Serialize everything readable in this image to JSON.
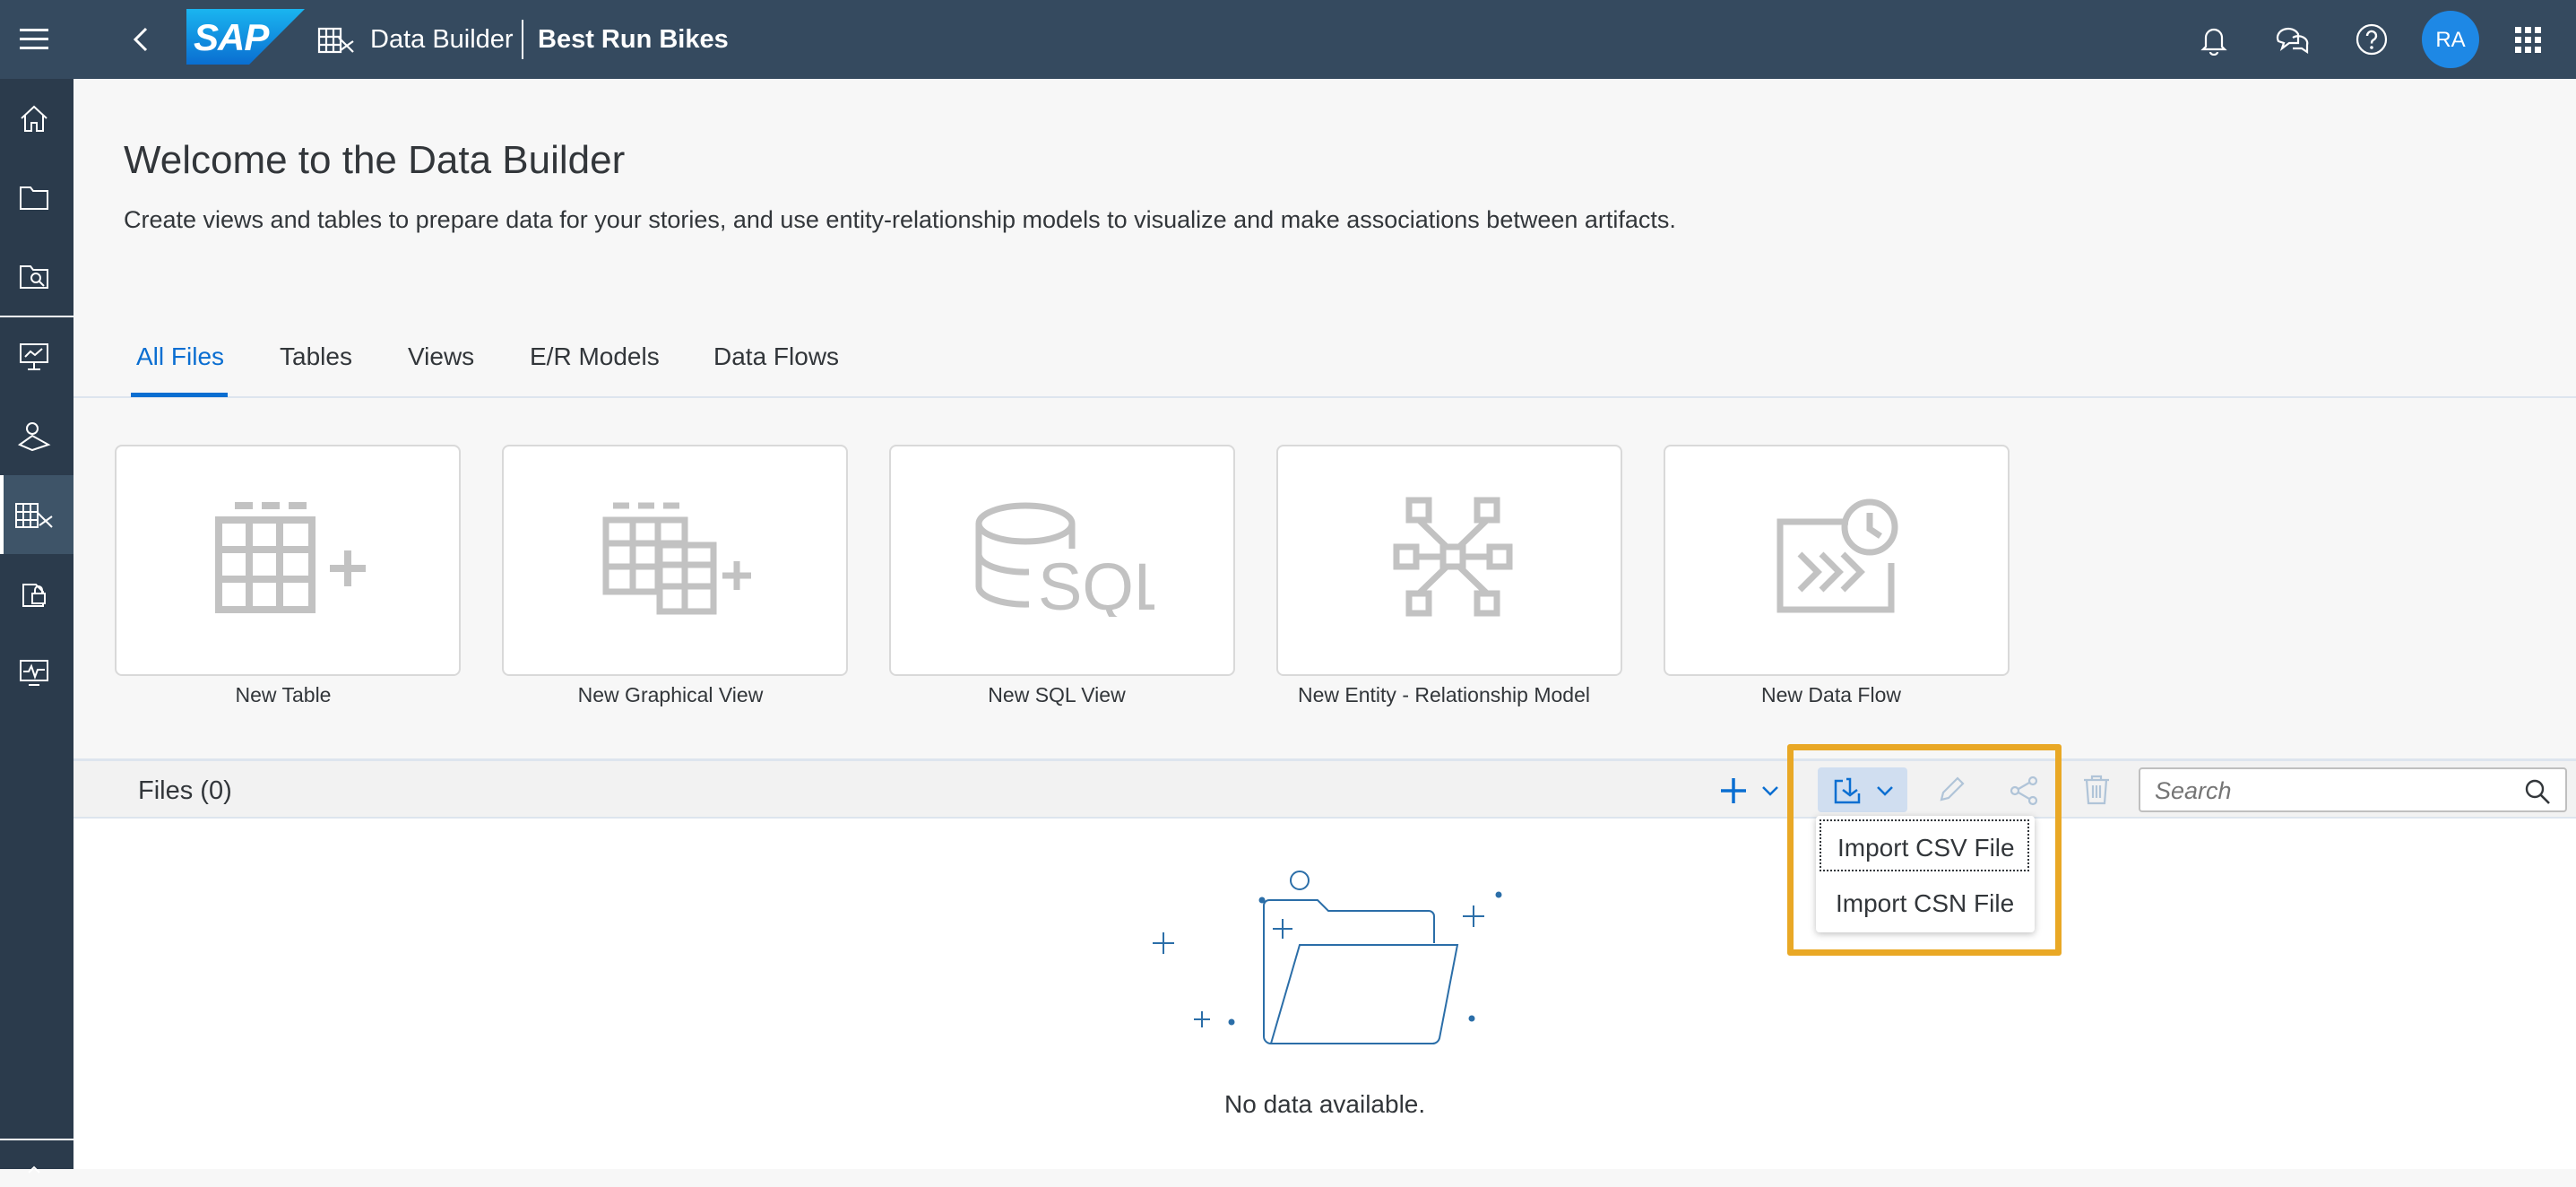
{
  "shell": {
    "logo_text": "SAP",
    "app_name": "Data Builder",
    "space_name": "Best Run Bikes",
    "avatar_initials": "RA"
  },
  "header": {
    "title": "Welcome to the Data Builder",
    "description": "Create views and tables to prepare data for your stories, and use entity-relationship models to visualize and make associations between artifacts."
  },
  "tabs": [
    {
      "label": "All Files",
      "selected": true
    },
    {
      "label": "Tables"
    },
    {
      "label": "Views"
    },
    {
      "label": "E/R Models"
    },
    {
      "label": "Data Flows"
    }
  ],
  "tiles": [
    {
      "label": "New Table",
      "icon": "table-add-icon"
    },
    {
      "label": "New Graphical View",
      "icon": "graphical-view-icon"
    },
    {
      "label": "New SQL View",
      "icon": "sql-icon"
    },
    {
      "label": "New Entity - Relationship Model",
      "icon": "er-model-icon"
    },
    {
      "label": "New Data Flow",
      "icon": "data-flow-icon"
    }
  ],
  "files": {
    "title": "Files (0)",
    "search_placeholder": "Search",
    "empty_text": "No data available."
  },
  "import_menu": {
    "items": [
      "Import CSV File",
      "Import CSN File"
    ]
  },
  "colors": {
    "shell_bg": "#354a5f",
    "sidebar_bg": "#2b3b4c",
    "accent": "#0a6ed1",
    "highlight": "#e9a825"
  }
}
